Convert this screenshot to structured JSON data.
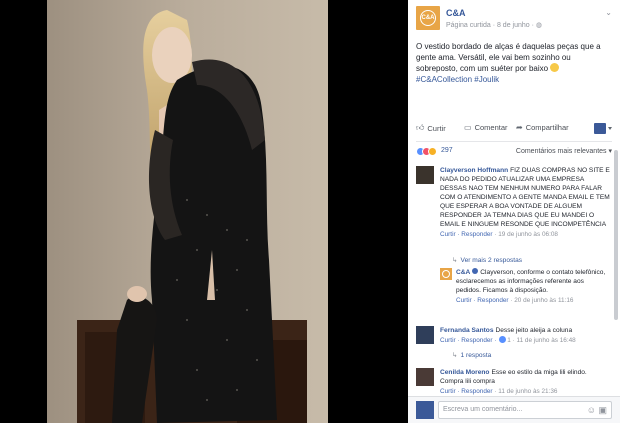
{
  "post": {
    "page_name": "C&A",
    "page_logo_text": "C&A",
    "meta": "Página curtida · 8 de junho · ",
    "text": "O vestido bordado de alças é daquelas peças que a gente ama. Versátil, ele vai bem sozinho ou sobreposto, com um suéter por baixo ",
    "hashtags": "#C&ACollection #Joulik"
  },
  "actions": {
    "like_label": "Curtir",
    "comment_label": "Comentar",
    "share_label": "Compartilhar"
  },
  "reactions": {
    "count": "297",
    "sort_label": "Comentários mais relevantes ▾"
  },
  "comments": [
    {
      "author": "Clayverson Hoffmann",
      "text": "FIZ DUAS COMPRAS NO SITE E NADA DO PEDIDO ATUALIZAR UMA EMPRESA DESSAS NAO TEM NENHUM NUMERO PARA FALAR COM O ATENDIMENTO A GENTE MANDA EMAIL E TEM QUE ESPERAR A BOA VONTADE DE ALGUEM RESPONDER JA TEMNA DIAS QUE EU MANDEI O EMAIL E NINGUEM RESONDE QUE INCOMPETÊNCIA",
      "reply_action": "Curtir · Responder",
      "date": " · 19 de junho às 06:08",
      "more_replies": "Ver mais 2 respostas",
      "reply": {
        "author": "C&A",
        "text": "Clayverson, conforme o contato telefônico, esclarecemos as informações referente aos pedidos. Ficamos à disposição.",
        "reply_action": "Curtir · Responder",
        "date": " · 20 de junho às 11:16"
      }
    },
    {
      "author": "Fernanda Santos",
      "text": "Desse jeito aleija a coluna",
      "reply_action": "Curtir · Responder · ",
      "like_count": "1",
      "date": " · 11 de junho às 16:48",
      "more_replies": "1 resposta"
    },
    {
      "author": "Cenilda Moreno",
      "text": "Esse eo estilo da miga lili elindo. Compra lili compra",
      "reply_action": "Curtir · Responder",
      "date": " · 11 de junho às 21:36"
    }
  ],
  "composer": {
    "placeholder": "Escreva um comentário..."
  },
  "colors": {
    "link": "#365899",
    "brand": "#e8a547"
  }
}
